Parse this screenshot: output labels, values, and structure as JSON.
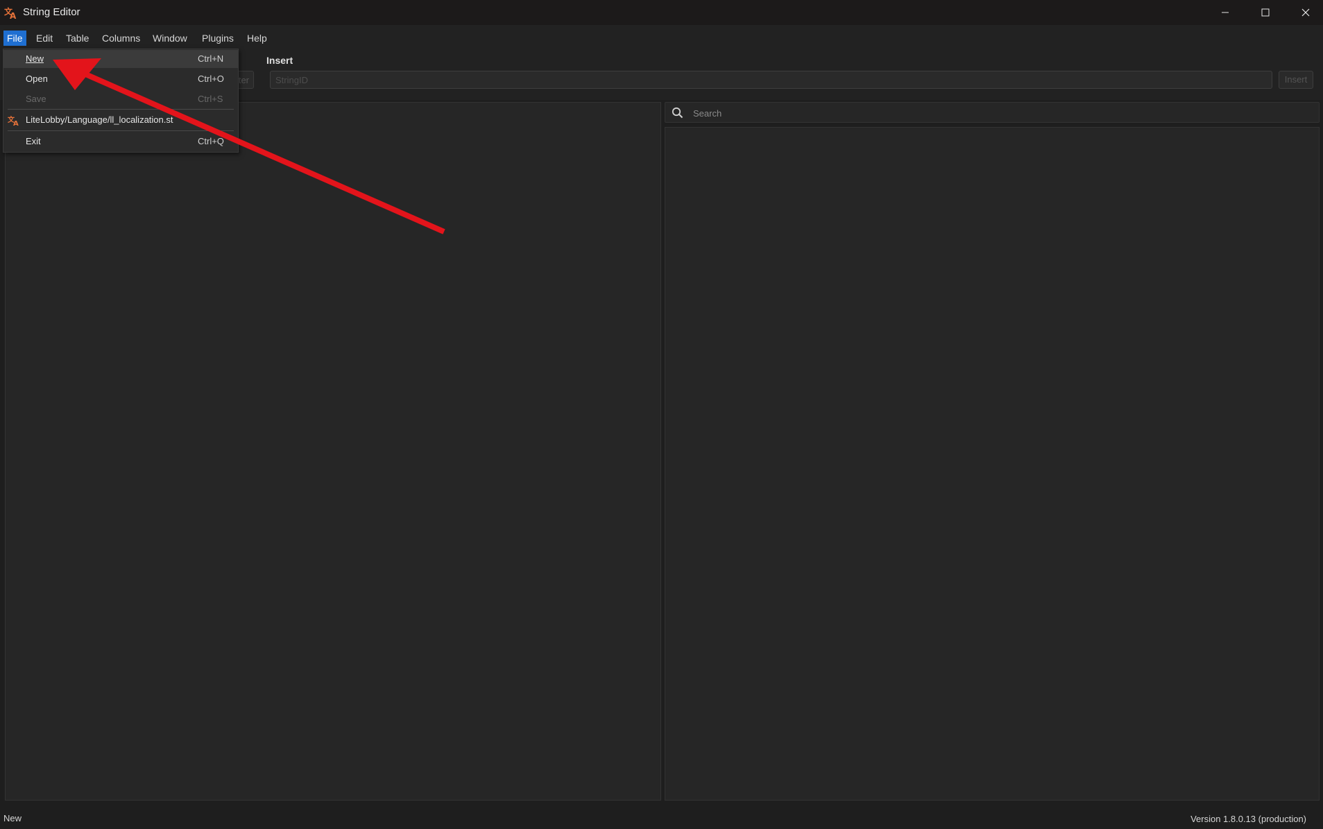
{
  "window": {
    "title": "String Editor",
    "icon": "translate-icon",
    "controls": [
      "minimize-icon",
      "maximize-icon",
      "close-icon"
    ]
  },
  "menubar": {
    "items": [
      {
        "label": "File",
        "active": true
      },
      {
        "label": "Edit"
      },
      {
        "label": "Table"
      },
      {
        "label": "Columns"
      },
      {
        "label": "Window"
      },
      {
        "label": "Plugins"
      },
      {
        "label": "Help"
      }
    ]
  },
  "file_menu": {
    "items": [
      {
        "label": "New",
        "shortcut": "Ctrl+N",
        "highlighted": true
      },
      {
        "label": "Open",
        "shortcut": "Ctrl+O"
      },
      {
        "label": "Save",
        "shortcut": "Ctrl+S",
        "disabled": true
      },
      {
        "label": "LiteLobby/Language/ll_localization.st",
        "icon": "translate-icon",
        "recent": true
      },
      {
        "label": "Exit",
        "shortcut": "Ctrl+Q"
      }
    ]
  },
  "toolbar": {
    "insert_label": "Insert",
    "filter_button": "Filter",
    "string_id_placeholder": "StringID",
    "insert_button": "Insert"
  },
  "search": {
    "placeholder": "Search",
    "icon": "search-icon"
  },
  "statusbar": {
    "left": "New",
    "right": "Version 1.8.0.13 (production)"
  },
  "colors": {
    "accent": "#1f6fd1",
    "icon_orange": "#e8733a",
    "annotation_arrow": "#e3141b",
    "background": "#1e1e1e",
    "panel": "#262626"
  }
}
